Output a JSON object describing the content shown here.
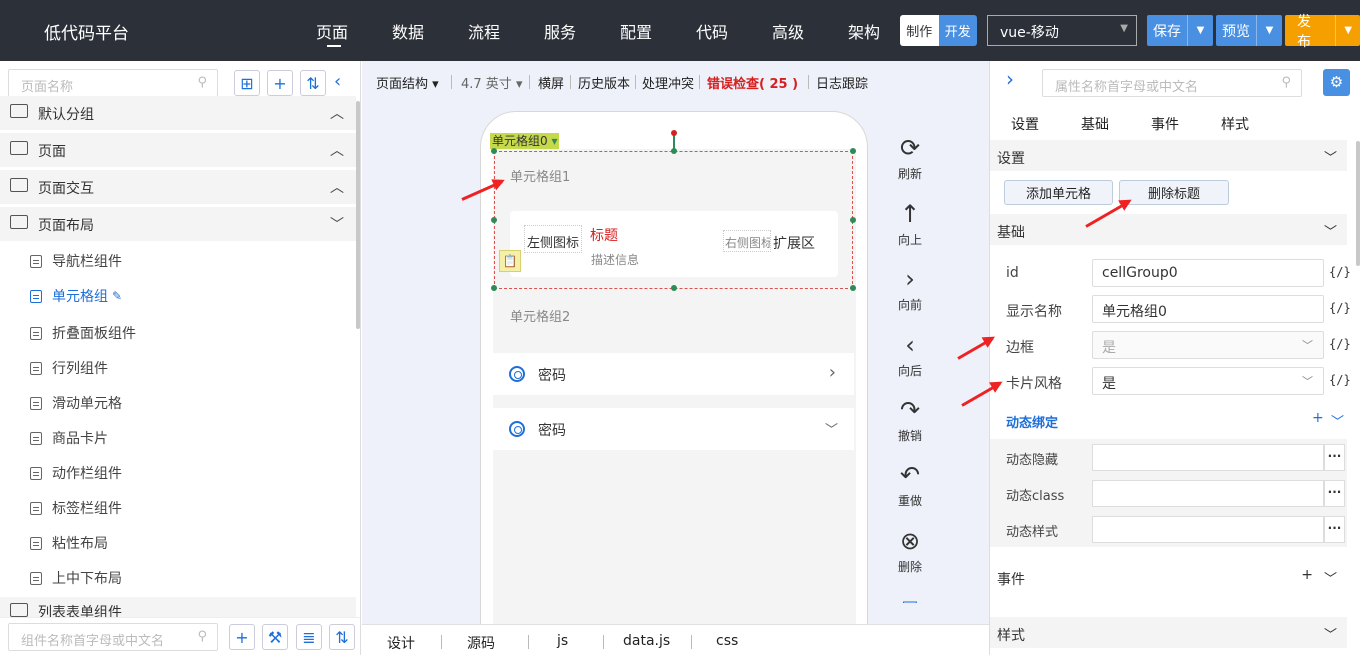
{
  "topbar": {
    "brand": "低代码平台",
    "nav": [
      "页面",
      "数据",
      "流程",
      "服务",
      "配置",
      "代码",
      "高级",
      "架构"
    ],
    "mode_make": "制作",
    "mode_dev": "开发",
    "platform": "vue-移动",
    "save": "保存",
    "preview": "预览",
    "publish": "发布",
    "colors": {
      "bg": "#2c3139",
      "save": "#4a90e2",
      "publish": "#f5a000"
    }
  },
  "left": {
    "search_placeholder": "页面名称",
    "groups": [
      "默认分组",
      "页面",
      "页面交互",
      "页面布局"
    ],
    "items": [
      "导航栏组件",
      "单元格组",
      "折叠面板组件",
      "行列组件",
      "滑动单元格",
      "商品卡片",
      "动作栏组件",
      "标签栏组件",
      "粘性布局",
      "上中下布局"
    ],
    "active_item": "单元格组",
    "cutoff_group": "列表表单组件",
    "bottom_search_placeholder": "组件名称首字母或中文名"
  },
  "center": {
    "toolbar": {
      "structure": "页面结构",
      "size": "4.7 英寸",
      "landscape": "横屏",
      "history": "历史版本",
      "conflict": "处理冲突",
      "error_check": "错误检查",
      "error_count": "( 25 )",
      "log": "日志跟踪"
    },
    "canvas": {
      "tag": "单元格组0",
      "group1": "单元格组1",
      "left_icon": "左侧图标",
      "title": "标题",
      "desc": "描述信息",
      "right_icon": "右侧图标",
      "extend": "扩展区",
      "group2": "单元格组2",
      "cell1": "密码",
      "cell2": "密码"
    },
    "tools": [
      "刷新",
      "向上",
      "向前",
      "向后",
      "撤销",
      "重做",
      "删除"
    ],
    "bottom_tabs": [
      "设计",
      "源码",
      "js",
      "data.js",
      "css"
    ]
  },
  "right": {
    "search_placeholder": "属性名称首字母或中文名",
    "tabs": [
      "设置",
      "基础",
      "事件",
      "样式"
    ],
    "sec_settings": "设置",
    "add_cell": "添加单元格",
    "delete_title": "删除标题",
    "sec_basic": "基础",
    "props": [
      {
        "label": "id",
        "value": "cellGroup0"
      },
      {
        "label": "显示名称",
        "value": "单元格组0"
      },
      {
        "label": "边框",
        "value": "是"
      },
      {
        "label": "卡片风格",
        "value": "是"
      }
    ],
    "dynamic": "动态绑定",
    "dyn_rows": [
      "动态隐藏",
      "动态class",
      "动态样式"
    ],
    "sec_events": "事件",
    "sec_style": "样式",
    "brace": "{/}"
  }
}
